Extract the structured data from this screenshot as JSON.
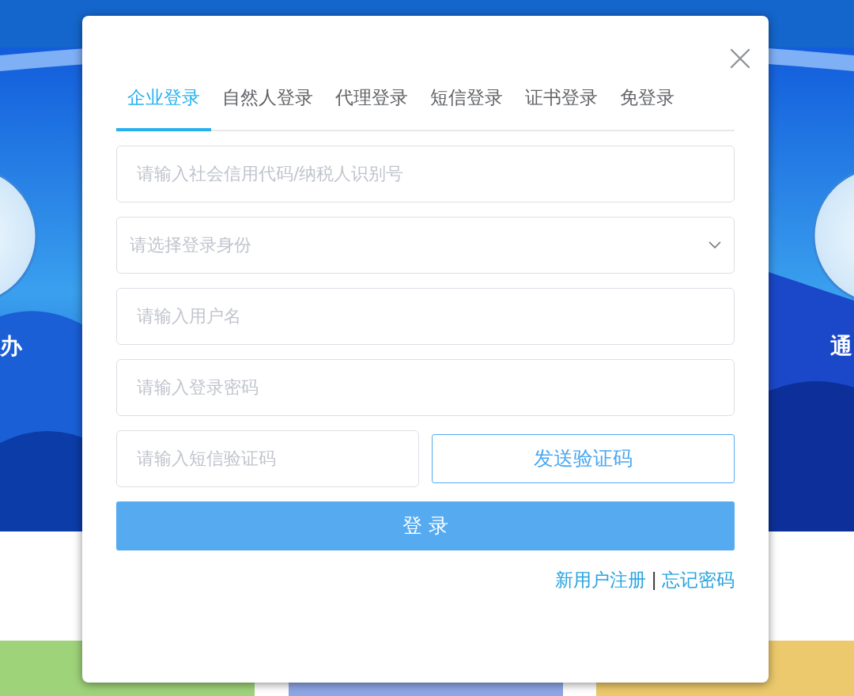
{
  "background": {
    "banner_labels": [
      {
        "text": "办"
      },
      {
        "text": "通"
      }
    ],
    "tiles": [
      {
        "color": "#9fd37a"
      },
      {
        "color": "#8ea6e6"
      },
      {
        "color": "#ecc96c"
      }
    ]
  },
  "dialog": {
    "tabs": [
      {
        "label": "企业登录",
        "selected": true
      },
      {
        "label": "自然人登录",
        "selected": false
      },
      {
        "label": "代理登录",
        "selected": false
      },
      {
        "label": "短信登录",
        "selected": false
      },
      {
        "label": "证书登录",
        "selected": false
      },
      {
        "label": "免登录",
        "selected": false
      }
    ],
    "fields": [
      {
        "kind": "input",
        "placeholder": "请输入社会信用代码/纳税人识别号"
      },
      {
        "kind": "select",
        "placeholder": "请选择登录身份"
      },
      {
        "kind": "input",
        "placeholder": "请输入用户名"
      },
      {
        "kind": "password",
        "placeholder": "请输入登录密码"
      }
    ],
    "sms": {
      "placeholder": "请输入短信验证码",
      "send_button": "发送验证码"
    },
    "login_button": "登 录",
    "links": [
      {
        "label": "新用户注册"
      },
      {
        "label": "忘记密码"
      }
    ],
    "separator": "|"
  }
}
